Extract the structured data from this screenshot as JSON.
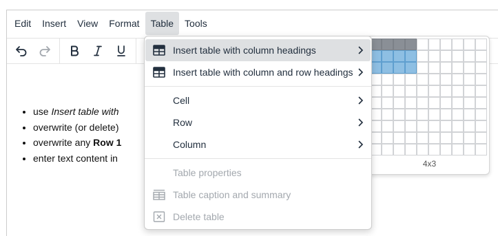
{
  "menubar": {
    "items": [
      {
        "label": "Edit"
      },
      {
        "label": "Insert"
      },
      {
        "label": "View"
      },
      {
        "label": "Format"
      },
      {
        "label": "Table"
      },
      {
        "label": "Tools"
      }
    ],
    "active": "Table"
  },
  "toolbar": {
    "buttons": [
      "undo-icon",
      "redo-icon",
      "bold-icon",
      "italic-icon",
      "underline-icon"
    ]
  },
  "content": {
    "list": [
      {
        "text": "use ",
        "em": "Insert table with"
      },
      {
        "text": "overwrite (or delete)"
      },
      {
        "text": "overwrite any ",
        "strong": "Row 1"
      },
      {
        "text": "enter text content in"
      }
    ]
  },
  "table_menu": {
    "items": [
      {
        "label": "Insert table with column headings",
        "icon": "table-icon",
        "submenu": true,
        "highlighted": true,
        "disabled": false
      },
      {
        "label": "Insert table with column and row headings",
        "icon": "table-icon",
        "submenu": true,
        "highlighted": false,
        "disabled": false
      },
      {
        "label": "Cell",
        "submenu": true,
        "disabled": false
      },
      {
        "label": "Row",
        "submenu": true,
        "disabled": false
      },
      {
        "label": "Column",
        "submenu": true,
        "disabled": false
      },
      {
        "label": "Table properties",
        "disabled": true
      },
      {
        "label": "Table caption and summary",
        "icon": "table-caption-icon",
        "disabled": true
      },
      {
        "label": "Delete table",
        "icon": "delete-table-icon",
        "disabled": true
      }
    ]
  },
  "grid_picker": {
    "columns": 10,
    "rows": 10,
    "selected_cols": 4,
    "selected_rows": 3,
    "label": "4x3"
  },
  "colors": {
    "menu_highlight": "#dee0e2",
    "header_cell": "#8a8f96",
    "selected_cell": "#8ebfe3",
    "disabled_text": "#a3a8ae"
  }
}
